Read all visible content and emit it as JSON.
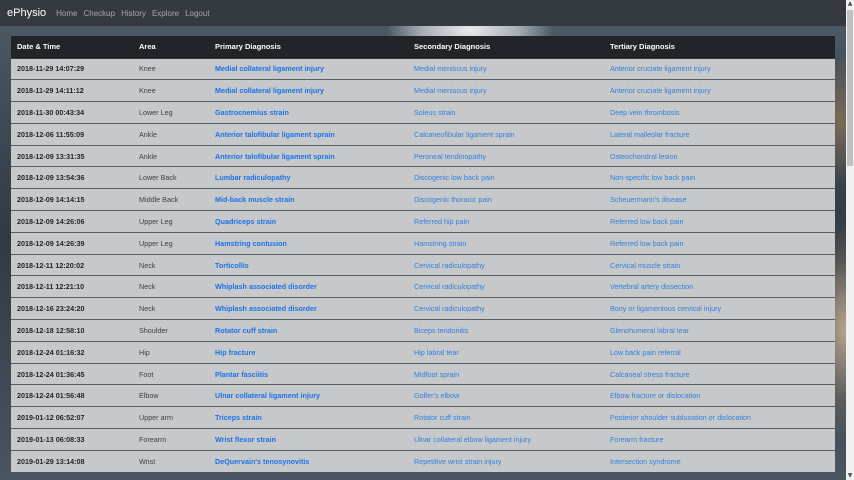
{
  "navbar": {
    "brand": "ePhysio",
    "links": [
      "Home",
      "Checkup",
      "History",
      "Explore",
      "Logout"
    ]
  },
  "table": {
    "headers": [
      "Date & Time",
      "Area",
      "Primary Diagnosis",
      "Secondary Diagnosis",
      "Tertiary Diagnosis"
    ],
    "rows": [
      [
        "2018-11-29 14:07:29",
        "Knee",
        "Medial collateral ligament injury",
        "Medial meniscus injury",
        "Anterior cruciate ligament injury"
      ],
      [
        "2018-11-29 14:11:12",
        "Knee",
        "Medial collateral ligament injury",
        "Medial meniscus injury",
        "Anterior cruciate ligament injury"
      ],
      [
        "2018-11-30 00:43:34",
        "Lower Leg",
        "Gastrocnemius strain",
        "Soleus strain",
        "Deep vein thrombosis"
      ],
      [
        "2018-12-06 11:55:09",
        "Ankle",
        "Anterior talofibular ligament sprain",
        "Calcaneofibular ligament sprain",
        "Lateral malleolar fracture"
      ],
      [
        "2018-12-09 13:31:35",
        "Ankle",
        "Anterior talofibular ligament sprain",
        "Peroneal tendinopathy",
        "Osteochondral lesion"
      ],
      [
        "2018-12-09 13:54:36",
        "Lower Back",
        "Lumbar radiculopathy",
        "Discogenic low back pain",
        "Non-specific low back pain"
      ],
      [
        "2018-12-09 14:14:15",
        "Middle Back",
        "Mid-back muscle strain",
        "Discogenic thoracic pain",
        "Scheuermann's disease"
      ],
      [
        "2018-12-09 14:26:06",
        "Upper Leg",
        "Quadriceps strain",
        "Referred hip pain",
        "Referred low back pain"
      ],
      [
        "2018-12-09 14:26:39",
        "Upper Leg",
        "Hamstring contusion",
        "Hamstring strain",
        "Referred low back pain"
      ],
      [
        "2018-12-11 12:20:02",
        "Neck",
        "Torticollis",
        "Cervical radiculopathy",
        "Cervical muscle strain"
      ],
      [
        "2018-12-11 12:21:10",
        "Neck",
        "Whiplash associated disorder",
        "Cervical radiculopathy",
        "Vertebral artery dissection"
      ],
      [
        "2018-12-16 23:24:20",
        "Neck",
        "Whiplash associated disorder",
        "Cervical radiculopathy",
        "Bony or ligamentous cervical injury"
      ],
      [
        "2018-12-18 12:58:10",
        "Shoulder",
        "Rotator cuff strain",
        "Biceps tendonitis",
        "Glenohumeral labral tear"
      ],
      [
        "2018-12-24 01:16:32",
        "Hip",
        "Hip fracture",
        "Hip labral tear",
        "Low back pain referral"
      ],
      [
        "2018-12-24 01:36:45",
        "Foot",
        "Plantar fasciitis",
        "Midfoot sprain",
        "Calcaneal stress fracture"
      ],
      [
        "2018-12-24 01:56:48",
        "Elbow",
        "Ulnar collateral ligament injury",
        "Golfer's elbow",
        "Elbow fracture or dislocation"
      ],
      [
        "2019-01-12 06:52:07",
        "Upper arm",
        "Triceps strain",
        "Rotator cuff strain",
        "Posterior shoulder subluxation or dislocation"
      ],
      [
        "2019-01-13 06:08:33",
        "Forearm",
        "Wrist flexor strain",
        "Ulnar collateral elbow ligament injury",
        "Forearm fracture"
      ],
      [
        "2019-01-29 13:14:08",
        "Wrist",
        "DeQuervain's tenosynovitis",
        "Repetitive wrist strain injury",
        "Intersection syndrome"
      ]
    ]
  }
}
